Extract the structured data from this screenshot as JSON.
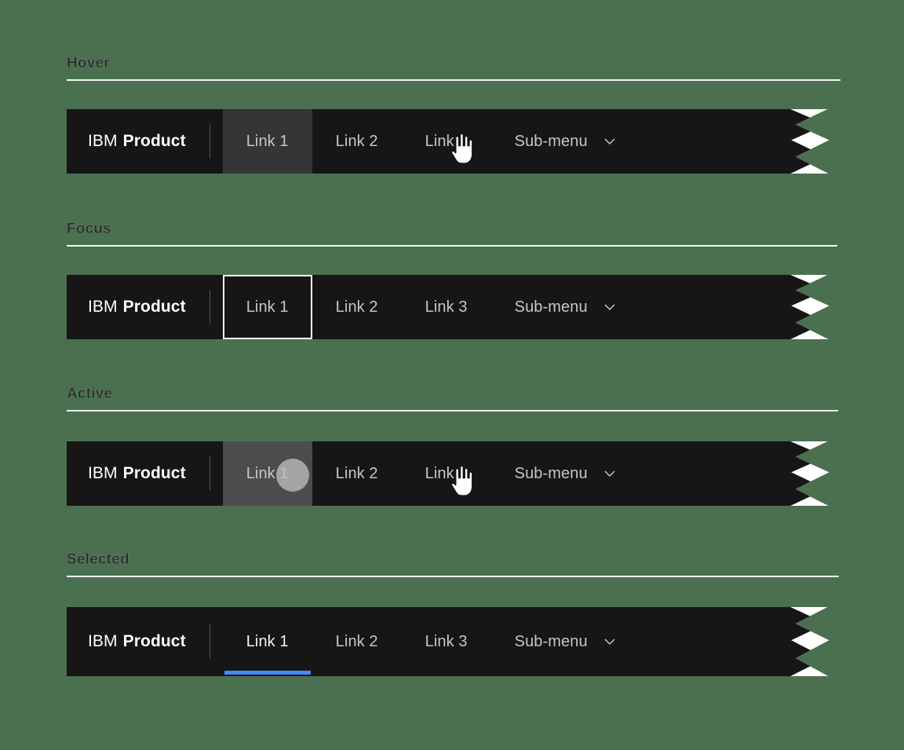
{
  "page": {
    "background_color": "#4a7050"
  },
  "palette": {
    "nav_background": "#161616",
    "link_text": "#c6c6c6",
    "brand_text": "#ffffff",
    "hover_background": "#353535",
    "active_background": "#4c4c4c",
    "focus_border": "#ffffff",
    "selected_indicator": "#4589ff",
    "divider": "#525252",
    "torn_edge": "#ffffff"
  },
  "brand": {
    "prefix": "IBM",
    "name": "Product"
  },
  "nav_links": {
    "link1": "Link 1",
    "link2": "Link 2",
    "link3": "Link 3",
    "submenu": "Sub-menu"
  },
  "icons": {
    "chevron_down": "chevron-down-icon",
    "pointer_cursor": "pointer-hand-cursor"
  },
  "sections": [
    {
      "id": "hover",
      "label": "Hover",
      "state": "hover",
      "state_note": "Link 1 has hover background and pointer cursor",
      "brand": {
        "prefix": "IBM",
        "name": "Product"
      },
      "links": [
        "Link 1",
        "Link 2",
        "Link 3",
        "Sub-menu"
      ]
    },
    {
      "id": "focus",
      "label": "Focus",
      "state": "focus",
      "state_note": "Link 1 has a white focus outline",
      "brand": {
        "prefix": "IBM",
        "name": "Product"
      },
      "links": [
        "Link 1",
        "Link 2",
        "Link 3",
        "Sub-menu"
      ]
    },
    {
      "id": "active",
      "label": "Active",
      "state": "active",
      "state_note": "Link 1 is pressed, showing ripple and pointer cursor",
      "brand": {
        "prefix": "IBM",
        "name": "Product"
      },
      "links": [
        "Link 1",
        "Link 2",
        "Link 3",
        "Sub-menu"
      ]
    },
    {
      "id": "selected",
      "label": "Selected",
      "state": "selected",
      "state_note": "Link 1 has blue underline indicator and brighter text",
      "brand": {
        "prefix": "IBM",
        "name": "Product"
      },
      "links": [
        "Link 1",
        "Link 2",
        "Link 3",
        "Sub-menu"
      ]
    }
  ]
}
